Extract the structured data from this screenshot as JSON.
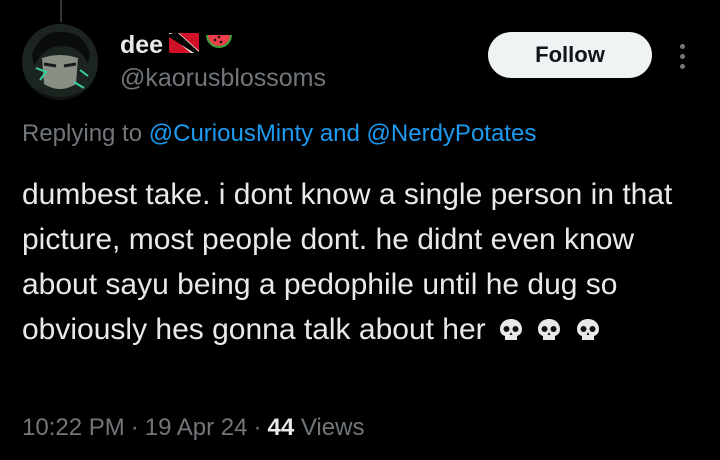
{
  "author": {
    "display_name": "dee",
    "handle": "@kaorusblossoms",
    "name_emojis": [
      "flag-trinidad-and-tobago-icon",
      "watermelon-icon"
    ]
  },
  "actions": {
    "follow_label": "Follow"
  },
  "reply": {
    "prefix": "Replying to",
    "mention1": "@CuriousMinty",
    "conjunction": "and",
    "mention2": "@NerdyPotates"
  },
  "tweet": {
    "text": "dumbest take. i dont know a single person in that picture, most people dont. he didnt even know about sayu being a pedophile until he dug so obviously hes gonna talk about her",
    "trailing_emojis": [
      "skull-icon",
      "skull-icon",
      "skull-icon"
    ]
  },
  "meta": {
    "time": "10:22 PM",
    "date": "19 Apr 24",
    "views_count": "44",
    "views_label": "Views"
  },
  "colors": {
    "background": "#000000",
    "text": "#e7e9ea",
    "muted": "#71767b",
    "link": "#1d9bf0",
    "follow_bg": "#eff3f4"
  }
}
